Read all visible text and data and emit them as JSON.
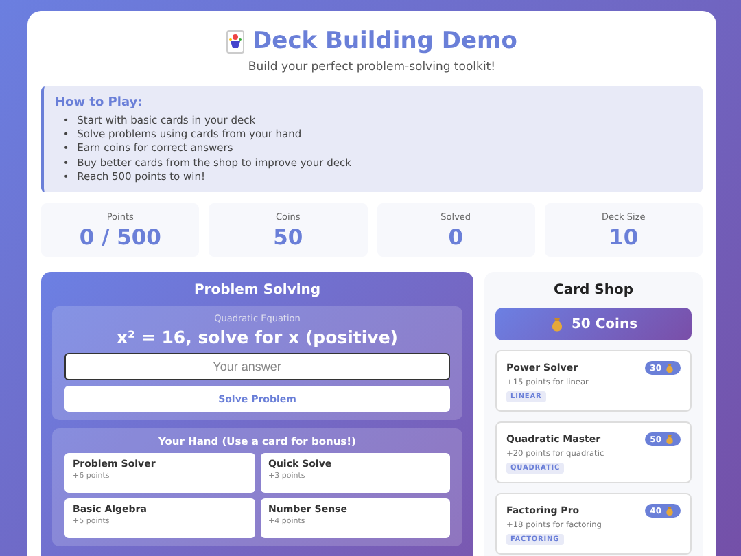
{
  "header": {
    "title": "Deck Building Demo",
    "subtitle": "Build your perfect problem-solving toolkit!"
  },
  "how_to_play": {
    "title": "How to Play:",
    "items": [
      {
        "marker": "•",
        "text": "Start with basic cards in your deck"
      },
      {
        "marker": "•",
        "text": "Solve problems using cards from your hand"
      },
      {
        "marker": "•",
        "text": "Earn coins for correct answers"
      },
      {
        "marker": "•",
        "text": "Buy better cards from the shop to improve your deck"
      },
      {
        "marker": "•",
        "text": "Reach 500 points to win!"
      }
    ]
  },
  "stats": [
    {
      "label": "Points",
      "value": "0 / 500"
    },
    {
      "label": "Coins",
      "value": "50"
    },
    {
      "label": "Solved",
      "value": "0"
    },
    {
      "label": "Deck Size",
      "value": "10"
    }
  ],
  "problem_panel": {
    "title": "Problem Solving",
    "problem_type": "Quadratic Equation",
    "problem": "x² = 16, solve for x (positive)",
    "answer": {
      "placeholder": "Your answer"
    },
    "solve_button": "Solve Problem"
  },
  "hand": {
    "title": "Your Hand (Use a card for bonus!)",
    "cards": [
      {
        "name": "Problem Solver",
        "points": "+6 points"
      },
      {
        "name": "Quick Solve",
        "points": "+3 points"
      },
      {
        "name": "Basic Algebra",
        "points": "+5 points"
      },
      {
        "name": "Number Sense",
        "points": "+4 points"
      }
    ]
  },
  "shop": {
    "title": "Card Shop",
    "coins": "50 Coins",
    "items": [
      {
        "name": "Power Solver",
        "price": "30",
        "description": "+15 points for linear",
        "tag": "LINEAR"
      },
      {
        "name": "Quadratic Master",
        "price": "50",
        "description": "+20 points for quadratic",
        "tag": "QUADRATIC"
      },
      {
        "name": "Factoring Pro",
        "price": "40",
        "description": "+18 points for factoring",
        "tag": "FACTORING"
      }
    ]
  }
}
